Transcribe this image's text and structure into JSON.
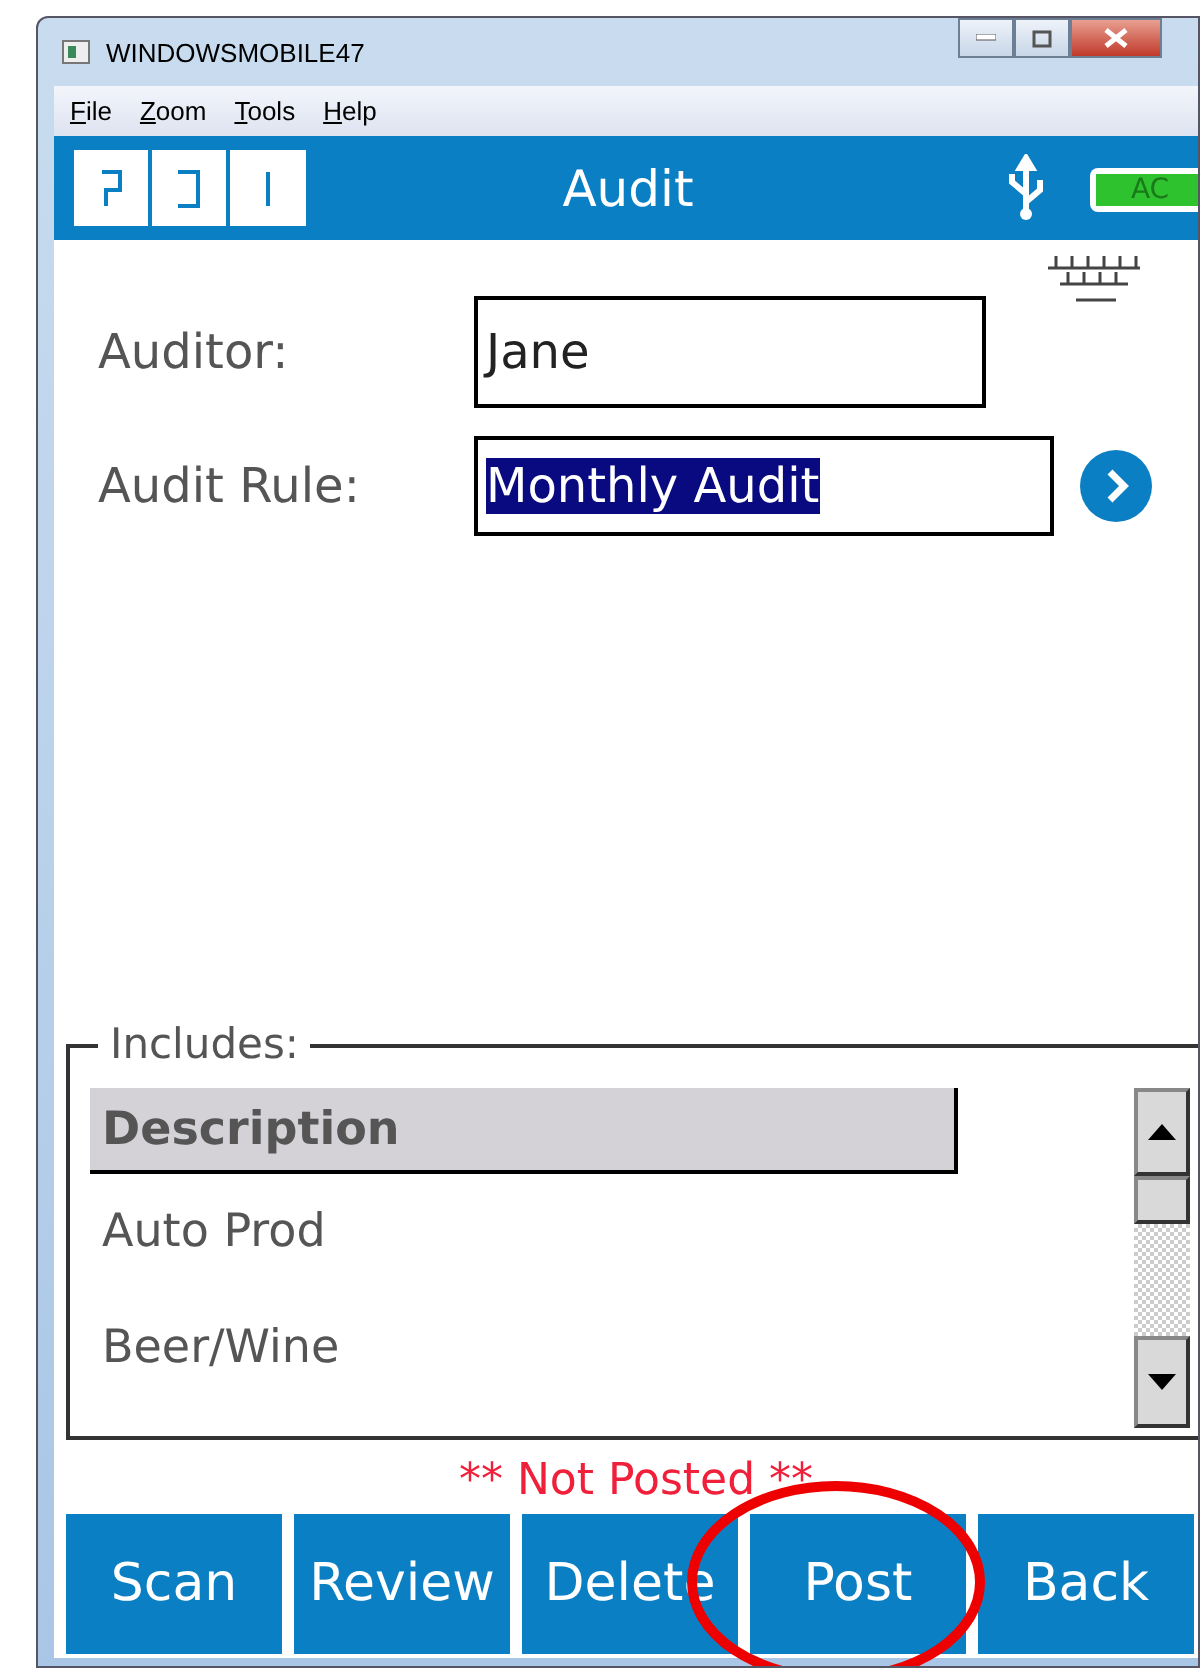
{
  "window": {
    "title": "WINDOWSMOBILE47"
  },
  "menu": [
    "File",
    "Zoom",
    "Tools",
    "Help"
  ],
  "header": {
    "title": "Audit",
    "battery": "AC"
  },
  "fields": [
    {
      "label": "Auditor:",
      "value": "Jane",
      "selected": false,
      "button": false
    },
    {
      "label": "Audit Rule:",
      "value": "Monthly Audit",
      "selected": true,
      "button": true
    }
  ],
  "includes": {
    "legend": "Includes:",
    "column": "Description",
    "rows": [
      "Auto Prod",
      "Beer/Wine"
    ]
  },
  "status": "** Not Posted **",
  "buttons": [
    {
      "label": "Scan",
      "circled": false
    },
    {
      "label": "Review",
      "circled": false
    },
    {
      "label": "Delete",
      "circled": false
    },
    {
      "label": "Post",
      "circled": true
    },
    {
      "label": "Back",
      "circled": false
    }
  ]
}
